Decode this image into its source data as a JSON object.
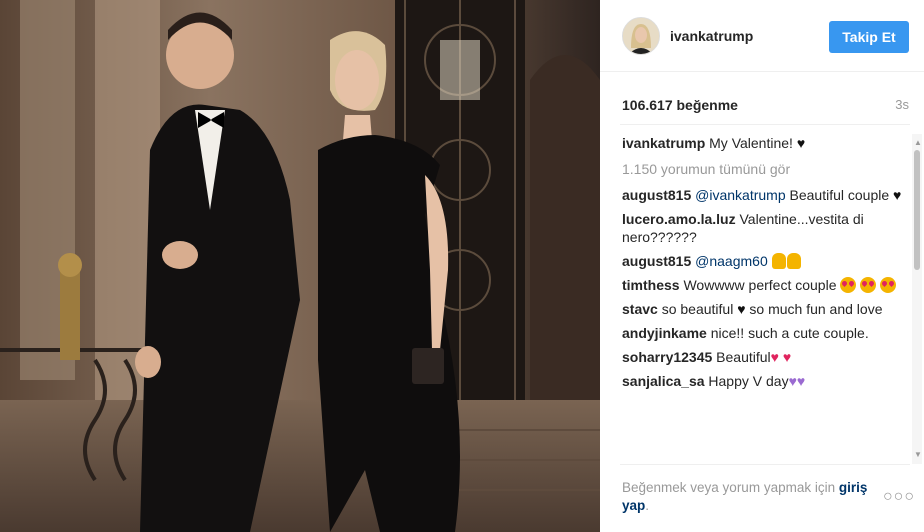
{
  "post": {
    "username": "ivankatrump",
    "follow_label": "Takip Et",
    "likes": "106.617 beğenme",
    "time": "3s"
  },
  "caption": {
    "user": "ivankatrump",
    "text": "My Valentine!",
    "emoji": "♥"
  },
  "view_all": "1.150 yorumun tümünü gör",
  "comments": [
    {
      "user": "august815",
      "mention": "@ivankatrump",
      "text": " Beautiful couple ",
      "emoji": "♥"
    },
    {
      "user": "lucero.amo.la.luz",
      "text": " Valentine...vestita di nero??????"
    },
    {
      "user": "august815",
      "mention": "@naagm60",
      "text": ""
    },
    {
      "user": "timthess",
      "text": " Wowwww perfect couple "
    },
    {
      "user": "stavc",
      "text": " so beautiful ",
      "text2": " so much fun and love"
    },
    {
      "user": "andyjinkame",
      "text": " nice!! such a cute couple."
    },
    {
      "user": "soharry12345",
      "text": " Beautiful"
    },
    {
      "user": "sanjalica_sa",
      "text": " Happy V day"
    }
  ],
  "footer": {
    "prompt": "Beğenmek veya yorum yapmak için",
    "login_link": "giriş yap",
    "login_suffix": ".",
    "more": "○○○"
  },
  "colors": {
    "accent": "#3897f0",
    "username": "#262626",
    "link": "#003569",
    "muted": "#999999"
  }
}
